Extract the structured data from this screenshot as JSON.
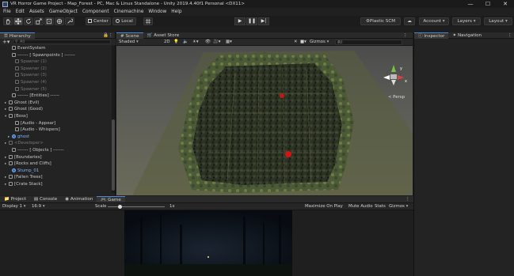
{
  "window": {
    "title": "VR Horror Game Project - Map_Forest - PC, Mac & Linux Standalone - Unity 2019.4.40f1 Personal <DX11>",
    "controls": [
      "—",
      "☐",
      "✕"
    ]
  },
  "menu": [
    "File",
    "Edit",
    "Assets",
    "GameObject",
    "Component",
    "Cinemachine",
    "Window",
    "Help"
  ],
  "toolbar": {
    "pivot": "Center",
    "space": "Local",
    "plastic": "Plastic SCM",
    "account": "Account",
    "layers": "Layers",
    "layout": "Layout"
  },
  "hierarchy": {
    "title": "Hierarchy",
    "search_placeholder": "All",
    "items": [
      {
        "label": "EventSystem",
        "style": "normal",
        "arrow": ""
      },
      {
        "label": "------- [ Spawnpoints ] -------",
        "style": "normal",
        "arrow": ""
      },
      {
        "label": "Spawner (1)",
        "style": "dim",
        "arrow": ""
      },
      {
        "label": "Spawner (2)",
        "style": "dim",
        "arrow": ""
      },
      {
        "label": "Spawner (3)",
        "style": "dim",
        "arrow": ""
      },
      {
        "label": "Spawner (4)",
        "style": "dim",
        "arrow": ""
      },
      {
        "label": "Spawner (5)",
        "style": "dim",
        "arrow": ""
      },
      {
        "label": "------- [Entities] ------",
        "style": "normal",
        "arrow": ""
      },
      {
        "label": "Ghost (Evil)",
        "style": "normal",
        "arrow": "▸"
      },
      {
        "label": "Ghost (Good)",
        "style": "normal",
        "arrow": "▸"
      },
      {
        "label": "[Boss]",
        "style": "normal",
        "arrow": "▾"
      },
      {
        "label": "[Audio - Appear]",
        "style": "normal",
        "arrow": ""
      },
      {
        "label": "[Audio - Whispers]",
        "style": "normal",
        "arrow": ""
      },
      {
        "label": "ghost",
        "style": "blue",
        "arrow": "▸"
      },
      {
        "label": "<Developer>",
        "style": "dim",
        "arrow": "▸"
      },
      {
        "label": "------- [ Objects ] -------",
        "style": "normal",
        "arrow": ""
      },
      {
        "label": "[Boundaries]",
        "style": "normal",
        "arrow": "▸"
      },
      {
        "label": "[Rocks and Cliffs]",
        "style": "normal",
        "arrow": "▸"
      },
      {
        "label": "Stump_01",
        "style": "blue",
        "arrow": ""
      },
      {
        "label": "[Fallen Trees]",
        "style": "normal",
        "arrow": "▸"
      },
      {
        "label": "[Crate Stack]",
        "style": "normal",
        "arrow": "▸"
      }
    ]
  },
  "scene": {
    "tabs": [
      "Scene",
      "Asset Store"
    ],
    "shading": "Shaded",
    "mode_2d": "2D",
    "gizmos": "Gizmos",
    "search_placeholder": "All",
    "persp_label": "< Persp"
  },
  "right_panel": {
    "tabs": [
      "Inspector",
      "Navigation"
    ]
  },
  "bottom": {
    "tabs": [
      "Project",
      "Console",
      "Animation",
      "Game"
    ],
    "display": "Display 1",
    "aspect": "16:9",
    "scale_label": "Scale",
    "scale_value": "1x",
    "maximize": "Maximize On Play",
    "mute": "Mute Audio",
    "stats": "Stats",
    "gizmos": "Gizmos"
  }
}
